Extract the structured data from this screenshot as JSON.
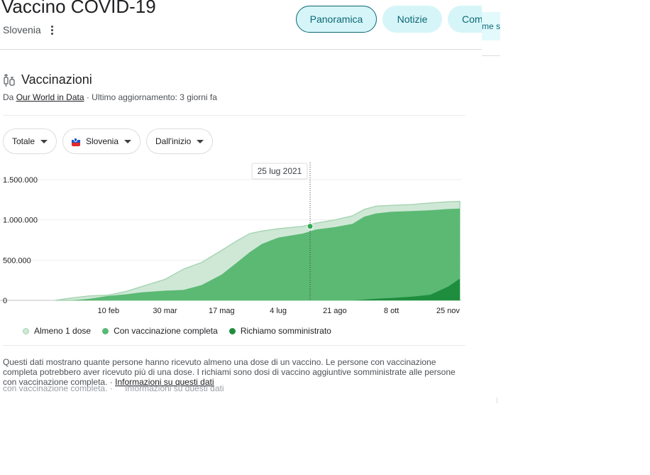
{
  "header": {
    "title": "Vaccino COVID-19",
    "location": "Slovenia",
    "tabs": [
      {
        "label": "Panoramica",
        "selected": true
      },
      {
        "label": "Notizie",
        "selected": false
      },
      {
        "label": "Com",
        "selected": false
      }
    ],
    "overflow_tab_text": "me s"
  },
  "section": {
    "title": "Vaccinazioni",
    "icon": "syringe-icon",
    "source_prefix": "Da ",
    "source_link": "Our World in Data",
    "source_suffix": " · Ultimo aggiornamento: 3 giorni fa"
  },
  "filters": {
    "measure": "Totale",
    "country": "Slovenia",
    "range": "Dall'inizio"
  },
  "chart_data": {
    "type": "area",
    "tooltip_date": "25 lug 2021",
    "x_tick_labels": [
      "10 feb",
      "30 mar",
      "17 mag",
      "4 lug",
      "21 ago",
      "8 ott",
      "25 nov"
    ],
    "y_tick_labels": [
      "1.500.000",
      "1.000.000",
      "500.000",
      "0"
    ],
    "ylim": [
      0,
      1500000
    ],
    "x": [
      "2020-12-27",
      "2021-01-10",
      "2021-01-25",
      "2021-02-10",
      "2021-02-25",
      "2021-03-10",
      "2021-03-30",
      "2021-04-15",
      "2021-04-30",
      "2021-05-17",
      "2021-05-30",
      "2021-06-10",
      "2021-06-20",
      "2021-07-04",
      "2021-07-25",
      "2021-08-05",
      "2021-08-21",
      "2021-09-05",
      "2021-09-15",
      "2021-09-25",
      "2021-10-08",
      "2021-10-25",
      "2021-11-10",
      "2021-11-25",
      "2021-12-05"
    ],
    "series": [
      {
        "name": "Almeno 1 dose",
        "color": "#cfe8d6",
        "values": [
          0,
          30000,
          55000,
          65000,
          110000,
          170000,
          260000,
          390000,
          470000,
          620000,
          740000,
          830000,
          860000,
          890000,
          920000,
          960000,
          1000000,
          1050000,
          1130000,
          1170000,
          1180000,
          1190000,
          1210000,
          1225000,
          1230000
        ]
      },
      {
        "name": "Con vaccinazione completa",
        "color": "#5bb974",
        "values": [
          0,
          0,
          20000,
          55000,
          75000,
          100000,
          120000,
          130000,
          190000,
          320000,
          470000,
          600000,
          700000,
          780000,
          830000,
          880000,
          910000,
          950000,
          1040000,
          1080000,
          1100000,
          1110000,
          1120000,
          1135000,
          1140000
        ]
      },
      {
        "name": "Richiamo somministrato",
        "color": "#1e8e3e",
        "values": [
          0,
          0,
          0,
          0,
          0,
          0,
          0,
          0,
          0,
          0,
          0,
          0,
          0,
          0,
          0,
          0,
          0,
          0,
          10000,
          20000,
          30000,
          45000,
          70000,
          170000,
          270000
        ]
      }
    ]
  }
}
